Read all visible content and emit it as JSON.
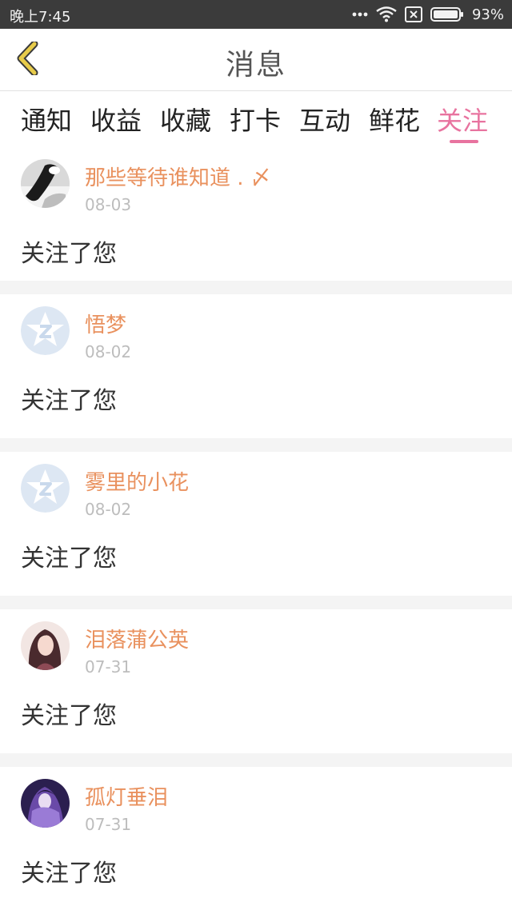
{
  "status_bar": {
    "time": "晚上7:45",
    "battery": "93%"
  },
  "header": {
    "title": "消息"
  },
  "tabs": [
    {
      "label": "通知"
    },
    {
      "label": "收益"
    },
    {
      "label": "收藏"
    },
    {
      "label": "打卡"
    },
    {
      "label": "互动"
    },
    {
      "label": "鲜花"
    },
    {
      "label": "关注",
      "active": true
    }
  ],
  "feed": [
    {
      "name": "那些等待谁知道 . 〆",
      "date": "08-03",
      "message": "关注了您",
      "avatar": "photo-avatar-bw"
    },
    {
      "name": "悟梦",
      "date": "08-02",
      "message": "关注了您",
      "avatar": "default-star-avatar"
    },
    {
      "name": "雾里的小花",
      "date": "08-02",
      "message": "关注了您",
      "avatar": "default-star-avatar"
    },
    {
      "name": "泪落蒲公英",
      "date": "07-31",
      "message": "关注了您",
      "avatar": "anime-avatar-pink"
    },
    {
      "name": "孤灯垂泪",
      "date": "07-31",
      "message": "关注了您",
      "avatar": "anime-avatar-purple"
    }
  ],
  "colors": {
    "accent": "#e8739f",
    "username": "#e9915e",
    "back_arrow": "#e7cb4a"
  }
}
